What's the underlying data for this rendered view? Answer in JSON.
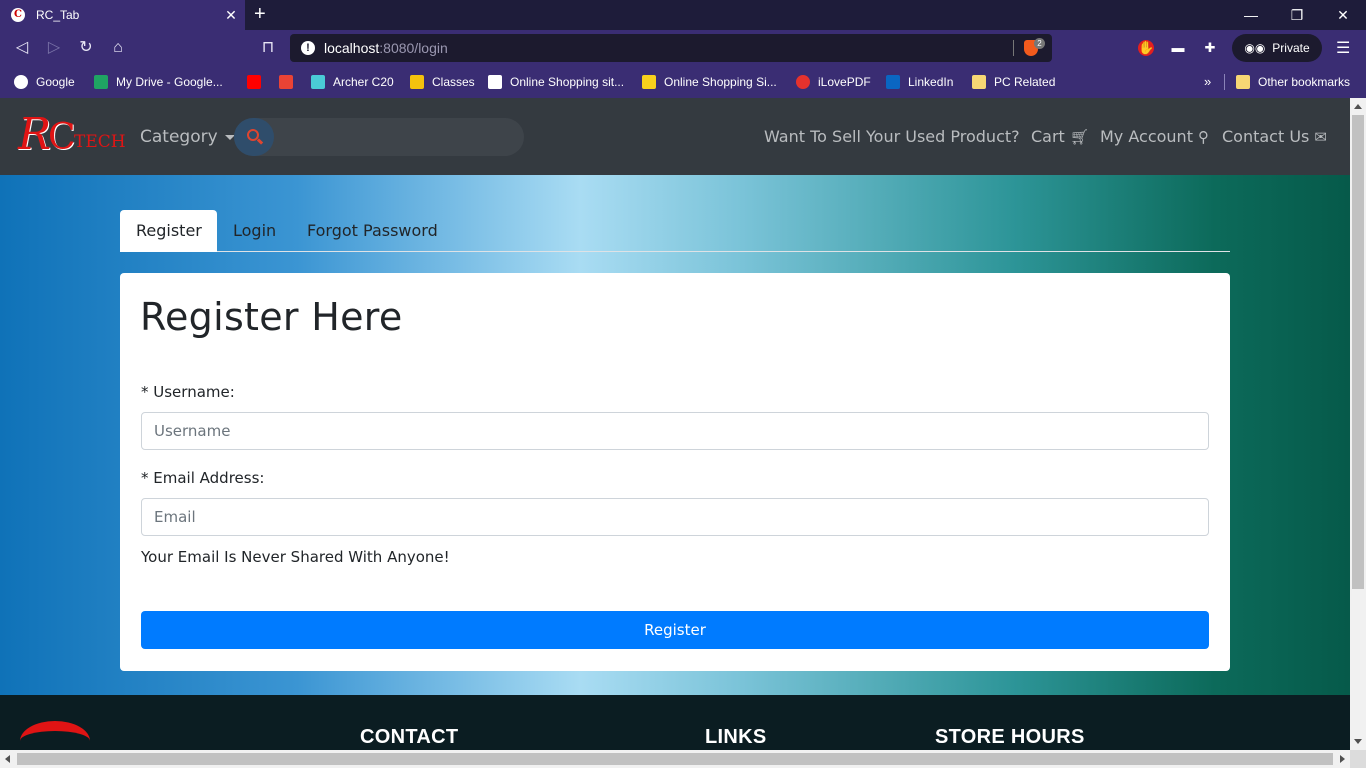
{
  "browser": {
    "tab_title": "RC_Tab",
    "tab_favicon": "C",
    "url_host": "localhost",
    "url_rest": ":8080/login",
    "shields_count": "2",
    "private_label": "Private",
    "window_controls": [
      "minimize-icon",
      "restore-icon",
      "close-icon"
    ]
  },
  "bookmarks": [
    {
      "label": "Google",
      "color": "#ffffff"
    },
    {
      "label": "My Drive - Google...",
      "color": "#1fa463"
    },
    {
      "label": "",
      "color": "#ff0000"
    },
    {
      "label": "",
      "color": "#ea4335"
    },
    {
      "label": "Archer C20",
      "color": "#4acbd6"
    },
    {
      "label": "Classes",
      "color": "#f4c20d"
    },
    {
      "label": "Online Shopping sit...",
      "color": "#ffffff"
    },
    {
      "label": "Online Shopping Si...",
      "color": "#f8d01c"
    },
    {
      "label": "iLovePDF",
      "color": "#e5322d"
    },
    {
      "label": "LinkedIn",
      "color": "#0a66c2"
    },
    {
      "label": "PC Related",
      "color": "#f7d774"
    }
  ],
  "bookmarks_overflow": "»",
  "other_bookmarks": "Other bookmarks",
  "site": {
    "logo_r": "R",
    "logo_c": "C",
    "logo_tech": "TECH",
    "nav": {
      "category": "Category",
      "search_placeholder": "",
      "sell": "Want To Sell Your Used Product?",
      "cart": "Cart",
      "account": "My Account",
      "contact": "Contact Us"
    },
    "tabs": [
      "Register",
      "Login",
      "Forgot Password"
    ],
    "form": {
      "heading": "Register Here",
      "username_label": "* Username:",
      "username_placeholder": "Username",
      "email_label": "* Email Address:",
      "email_placeholder": "Email",
      "email_help": "Your Email Is Never Shared With Anyone!",
      "submit": "Register"
    },
    "footer": {
      "contact": "CONTACT",
      "links": "LINKS",
      "hours": "STORE HOURS"
    }
  },
  "colors": {
    "nav_bg": "#343a40",
    "primary": "#007bff",
    "logo_red": "#e01414"
  }
}
